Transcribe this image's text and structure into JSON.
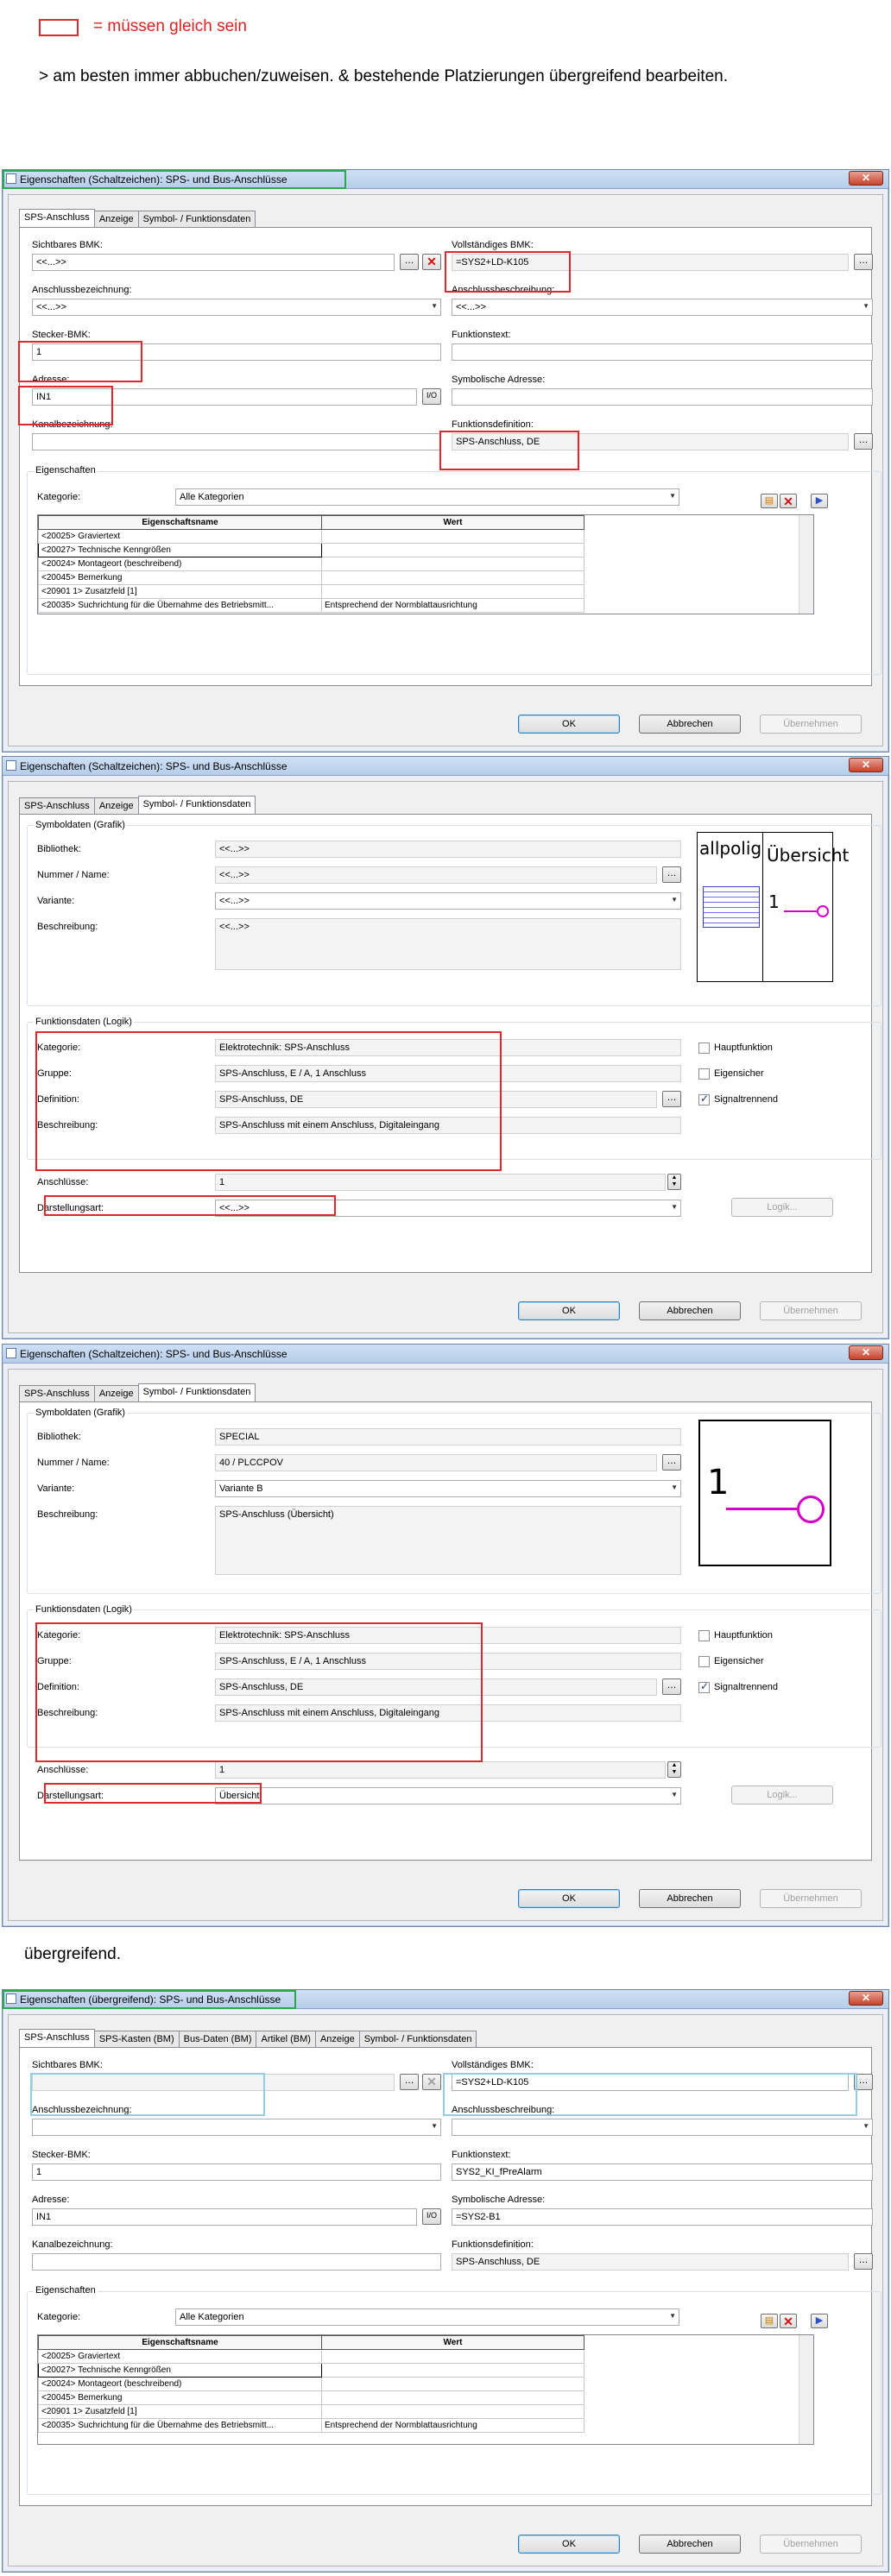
{
  "notes": {
    "legend": "= müssen gleich sein",
    "tip": "> am besten immer abbuchen/zuweisen. & bestehende Platzierungen übergreifend bearbeiten.",
    "overarching_heading": "übergreifend."
  },
  "buttons": {
    "ok": "OK",
    "cancel": "Abbrechen",
    "apply": "Übernehmen"
  },
  "icons": {
    "close": "close-icon",
    "browse": "ellipsis-icon",
    "clear": "red-x-icon",
    "address": "io-icon"
  },
  "colors": {
    "highlight_equal": "#e0262f",
    "highlight_cyan": "#8fd0e8",
    "highlight_window": "#2aa84a",
    "symbol_magenta": "#d400c8"
  },
  "dialog1": {
    "title": "Eigenschaften (Schaltzeichen): SPS- und Bus-Anschlüsse",
    "tabs": [
      "SPS-Anschluss",
      "Anzeige",
      "Symbol- / Funktionsdaten"
    ],
    "visible_bmk_label": "Sichtbares BMK:",
    "visible_bmk_value": "<<...>>",
    "full_bmk_label": "Vollständiges BMK:",
    "full_bmk_value": "=SYS2+LD-K105",
    "conn_designation_label": "Anschlussbezeichnung:",
    "conn_designation_value": "<<...>>",
    "conn_description_label": "Anschlussbeschreibung:",
    "conn_description_value": "<<...>>",
    "plug_bmk_label": "Stecker-BMK:",
    "plug_bmk_value": "1",
    "function_text_label": "Funktionstext:",
    "function_text_value": "",
    "address_label": "Adresse:",
    "address_value": "IN1",
    "symbolic_address_label": "Symbolische Adresse:",
    "symbolic_address_value": "",
    "channel_label": "Kanalbezeichnung:",
    "channel_value": "",
    "function_def_label": "Funktionsdefinition:",
    "function_def_value": "SPS-Anschluss, DE",
    "properties_group": "Eigenschaften",
    "category_label": "Kategorie:",
    "category_value": "Alle Kategorien",
    "table_headers": [
      "Eigenschaftsname",
      "Wert"
    ],
    "table_rows": [
      [
        "<20025> Graviertext",
        ""
      ],
      [
        "<20027> Technische Kenngrößen",
        ""
      ],
      [
        "<20024> Montageort (beschreibend)",
        ""
      ],
      [
        "<20045> Bemerkung",
        ""
      ],
      [
        "<20901 1> Zusatzfeld [1]",
        ""
      ],
      [
        "<20035> Suchrichtung für die Übernahme des Betriebsmitt...",
        "Entsprechend der Normblattausrichtung"
      ]
    ]
  },
  "dialog2": {
    "title": "Eigenschaften (Schaltzeichen): SPS- und Bus-Anschlüsse",
    "tabs": [
      "SPS-Anschluss",
      "Anzeige",
      "Symbol- / Funktionsdaten"
    ],
    "symbol_group": "Symboldaten (Grafik)",
    "library_label": "Bibliothek:",
    "library_value": "<<...>>",
    "number_label": "Nummer / Name:",
    "number_value": "<<...>>",
    "variant_label": "Variante:",
    "variant_value": "<<...>>",
    "description_label": "Beschreibung:",
    "description_value": "<<...>>",
    "preview_left": "allpolig",
    "preview_right": "Übersicht",
    "preview_num": "1",
    "function_group": "Funktionsdaten (Logik)",
    "f_category_label": "Kategorie:",
    "f_category_value": "Elektrotechnik: SPS-Anschluss",
    "f_group_label": "Gruppe:",
    "f_group_value": "SPS-Anschluss, E / A, 1 Anschluss",
    "f_definition_label": "Definition:",
    "f_definition_value": "SPS-Anschluss, DE",
    "f_description_label": "Beschreibung:",
    "f_description_value": "SPS-Anschluss mit einem Anschluss, Digitaleingang",
    "main_function": "Hauptfunktion",
    "intrinsic_safe": "Eigensicher",
    "signal_isolating": "Signaltrennend",
    "connections_label": "Anschlüsse:",
    "connections_value": "1",
    "display_type_label": "Darstellungsart:",
    "display_type_value": "<<...>>",
    "logic_button": "Logik..."
  },
  "dialog3": {
    "title": "Eigenschaften (Schaltzeichen): SPS- und Bus-Anschlüsse",
    "tabs": [
      "SPS-Anschluss",
      "Anzeige",
      "Symbol- / Funktionsdaten"
    ],
    "symbol_group": "Symboldaten (Grafik)",
    "library_label": "Bibliothek:",
    "library_value": "SPECIAL",
    "number_label": "Nummer / Name:",
    "number_value": "40 / PLCCPOV",
    "variant_label": "Variante:",
    "variant_value": "Variante B",
    "description_label": "Beschreibung:",
    "description_value": "SPS-Anschluss (Übersicht)",
    "preview_num": "1",
    "function_group": "Funktionsdaten (Logik)",
    "f_category_label": "Kategorie:",
    "f_category_value": "Elektrotechnik: SPS-Anschluss",
    "f_group_label": "Gruppe:",
    "f_group_value": "SPS-Anschluss, E / A, 1 Anschluss",
    "f_definition_label": "Definition:",
    "f_definition_value": "SPS-Anschluss, DE",
    "f_description_label": "Beschreibung:",
    "f_description_value": "SPS-Anschluss mit einem Anschluss, Digitaleingang",
    "main_function": "Hauptfunktion",
    "intrinsic_safe": "Eigensicher",
    "signal_isolating": "Signaltrennend",
    "connections_label": "Anschlüsse:",
    "connections_value": "1",
    "display_type_label": "Darstellungsart:",
    "display_type_value": "Übersicht",
    "logic_button": "Logik..."
  },
  "dialog4": {
    "title": "Eigenschaften (übergreifend): SPS- und Bus-Anschlüsse",
    "tabs": [
      "SPS-Anschluss",
      "SPS-Kasten (BM)",
      "Bus-Daten (BM)",
      "Artikel (BM)",
      "Anzeige",
      "Symbol- / Funktionsdaten"
    ],
    "visible_bmk_label": "Sichtbares BMK:",
    "visible_bmk_value": "",
    "full_bmk_label": "Vollständiges BMK:",
    "full_bmk_value": "=SYS2+LD-K105",
    "conn_designation_label": "Anschlussbezeichnung:",
    "conn_designation_value": "",
    "conn_description_label": "Anschlussbeschreibung:",
    "conn_description_value": "",
    "plug_bmk_label": "Stecker-BMK:",
    "plug_bmk_value": "1",
    "function_text_label": "Funktionstext:",
    "function_text_value": "SYS2_KI_fPreAlarm",
    "address_label": "Adresse:",
    "address_value": "IN1",
    "symbolic_address_label": "Symbolische Adresse:",
    "symbolic_address_value": "=SYS2-B1",
    "channel_label": "Kanalbezeichnung:",
    "channel_value": "",
    "function_def_label": "Funktionsdefinition:",
    "function_def_value": "SPS-Anschluss, DE",
    "properties_group": "Eigenschaften",
    "category_label": "Kategorie:",
    "category_value": "Alle Kategorien",
    "table_headers": [
      "Eigenschaftsname",
      "Wert"
    ],
    "table_rows": [
      [
        "<20025> Graviertext",
        ""
      ],
      [
        "<20027> Technische Kenngrößen",
        ""
      ],
      [
        "<20024> Montageort (beschreibend)",
        ""
      ],
      [
        "<20045> Bemerkung",
        ""
      ],
      [
        "<20901 1> Zusatzfeld [1]",
        ""
      ],
      [
        "<20035> Suchrichtung für die Übernahme des Betriebsmitt...",
        "Entsprechend der Normblattausrichtung"
      ]
    ]
  }
}
